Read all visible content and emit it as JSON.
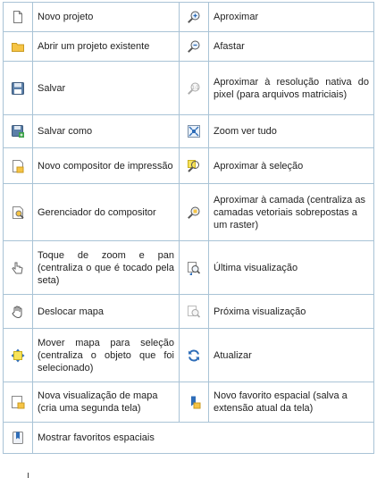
{
  "rows": [
    {
      "left": {
        "icon": "new-project-icon",
        "label": "Novo projeto"
      },
      "right": {
        "icon": "zoom-in-icon",
        "label": "Aproximar"
      }
    },
    {
      "left": {
        "icon": "open-project-icon",
        "label": "Abrir um projeto existente"
      },
      "right": {
        "icon": "zoom-out-icon",
        "label": "Afastar"
      }
    },
    {
      "left": {
        "icon": "save-icon",
        "label": "Salvar"
      },
      "right": {
        "icon": "zoom-native-resolution-icon",
        "label": "Aproximar à resolução nativa do pixel (para arquivos matriciais)"
      }
    },
    {
      "left": {
        "icon": "save-as-icon",
        "label": "Salvar como"
      },
      "right": {
        "icon": "zoom-full-icon",
        "label": "Zoom ver tudo"
      }
    },
    {
      "left": {
        "icon": "new-print-composer-icon",
        "label": "Novo compositor de impressão"
      },
      "right": {
        "icon": "zoom-to-selection-icon",
        "label": "Aproximar à seleção"
      }
    },
    {
      "left": {
        "icon": "composer-manager-icon",
        "label": "Gerenciador do compositor"
      },
      "right": {
        "icon": "zoom-to-layer-icon",
        "label": "Aproximar à camada (centraliza as camadas vetoriais sobrepostas a um raster)"
      }
    },
    {
      "left": {
        "icon": "touch-zoom-pan-icon",
        "label": "Toque de zoom e pan (centraliza o que é tocado pela seta)"
      },
      "right": {
        "icon": "zoom-last-icon",
        "label": "Última visualização"
      }
    },
    {
      "left": {
        "icon": "pan-map-icon",
        "label": "Deslocar mapa"
      },
      "right": {
        "icon": "zoom-next-icon",
        "label": "Próxima visualização"
      }
    },
    {
      "left": {
        "icon": "pan-to-selection-icon",
        "label": "Mover mapa para seleção (centraliza o objeto que foi selecionado)"
      },
      "right": {
        "icon": "refresh-icon",
        "label": "Atualizar"
      }
    },
    {
      "left": {
        "icon": "new-map-view-icon",
        "label": "Nova visualização de mapa (cria uma segunda tela)"
      },
      "right": {
        "icon": "new-spatial-bookmark-icon",
        "label": "Novo favorito espacial (salva a extensão atual da tela)"
      }
    },
    {
      "left": {
        "icon": "show-spatial-bookmarks-icon",
        "label": "Mostrar favoritos espaciais"
      }
    }
  ]
}
